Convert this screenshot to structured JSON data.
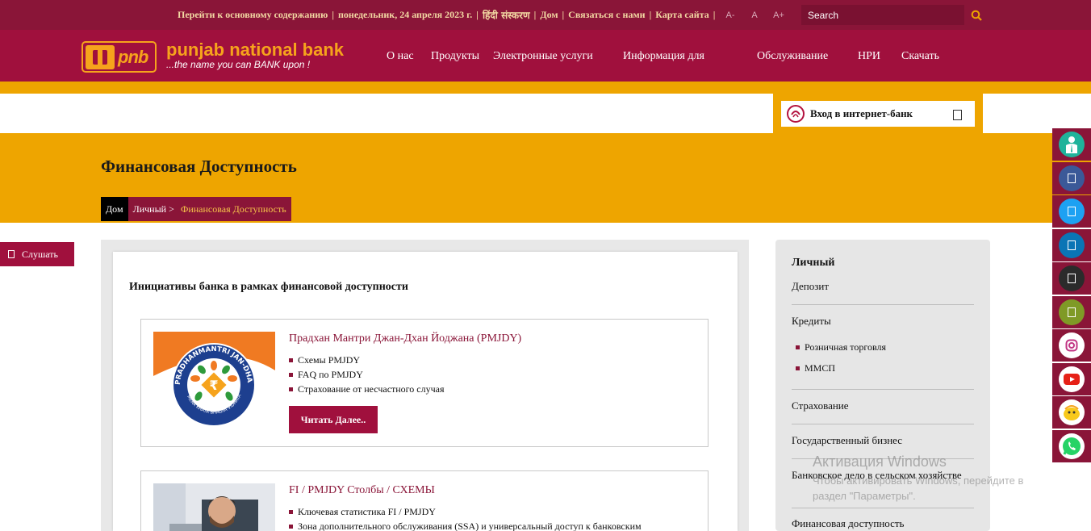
{
  "topbar": {
    "skip": "Перейти к основному содержанию",
    "date": "понедельник, 24 апреля 2023 г.",
    "hindi": "हिंदी संस्करण",
    "home": "Дом",
    "contact": "Связаться с нами",
    "sitemap": "Карта сайта",
    "font_small": "A-",
    "font_normal": "A",
    "font_large": "A+",
    "search_placeholder": "Search"
  },
  "brand": {
    "logo_text": "pnb",
    "name": "punjab national bank",
    "tagline": "...the name you can BANK upon !"
  },
  "nav": {
    "about": "О нас",
    "products": "Продукты",
    "eservices": "Электронные услуги",
    "info_for": "Информация для",
    "service": "Обслуживание",
    "nri": "НРИ",
    "download": "Скачать"
  },
  "login": {
    "label": "Вход в интернет-банк"
  },
  "page": {
    "title": "Финансовая Доступность",
    "breadcrumb": {
      "home": "Дом",
      "personal": "Личный >",
      "current": "Финансовая Доступность"
    }
  },
  "listen": {
    "label": "Слушать"
  },
  "content": {
    "heading": "Инициативы банка в рамках финансовой доступности",
    "card1": {
      "title": "Прадхан Мантри Джан-Дхан Йоджана (PMJDY)",
      "items": [
        "Схемы PMJDY",
        "FAQ по PMJDY",
        "Страхование от несчастного случая"
      ],
      "button": "Читать Далее..",
      "logo_ring_text": "PRADHANMANTRI JAN-DHAN YOJANA",
      "logo_bottom_text": "MERA KHATA BHAGYA VIDHATA"
    },
    "card2": {
      "title": "FI / PMJDY Столбы / СХЕМЫ",
      "items": [
        "Ключевая статистика FI / PMJDY",
        "Зона дополнительного обслуживания (SSA) и универсальный доступ к банковским"
      ]
    }
  },
  "sidebar": {
    "title": "Личный",
    "deposit": "Депозит",
    "loans": "Кредиты",
    "retail": "Розничная торговля",
    "msme": "ММСП",
    "insurance": "Страхование",
    "govt": "Государственный бизнес",
    "rural": "Банковское дело в сельском хозяйстве",
    "fi": "Финансовая доступность"
  },
  "social": [
    "account-icon",
    "facebook-icon",
    "twitter-icon",
    "linkedin-icon",
    "blog-icon",
    "feed-icon",
    "instagram-icon",
    "youtube-icon",
    "chatbot-icon",
    "whatsapp-icon"
  ],
  "watermark": {
    "line1": "Активация Windows",
    "line2": "Чтобы активировать Windows, перейдите в",
    "line3": "раздел \"Параметры\"."
  },
  "colors": {
    "maroon": "#a0103d",
    "dark_maroon": "#8a1538",
    "gold": "#eea500"
  }
}
